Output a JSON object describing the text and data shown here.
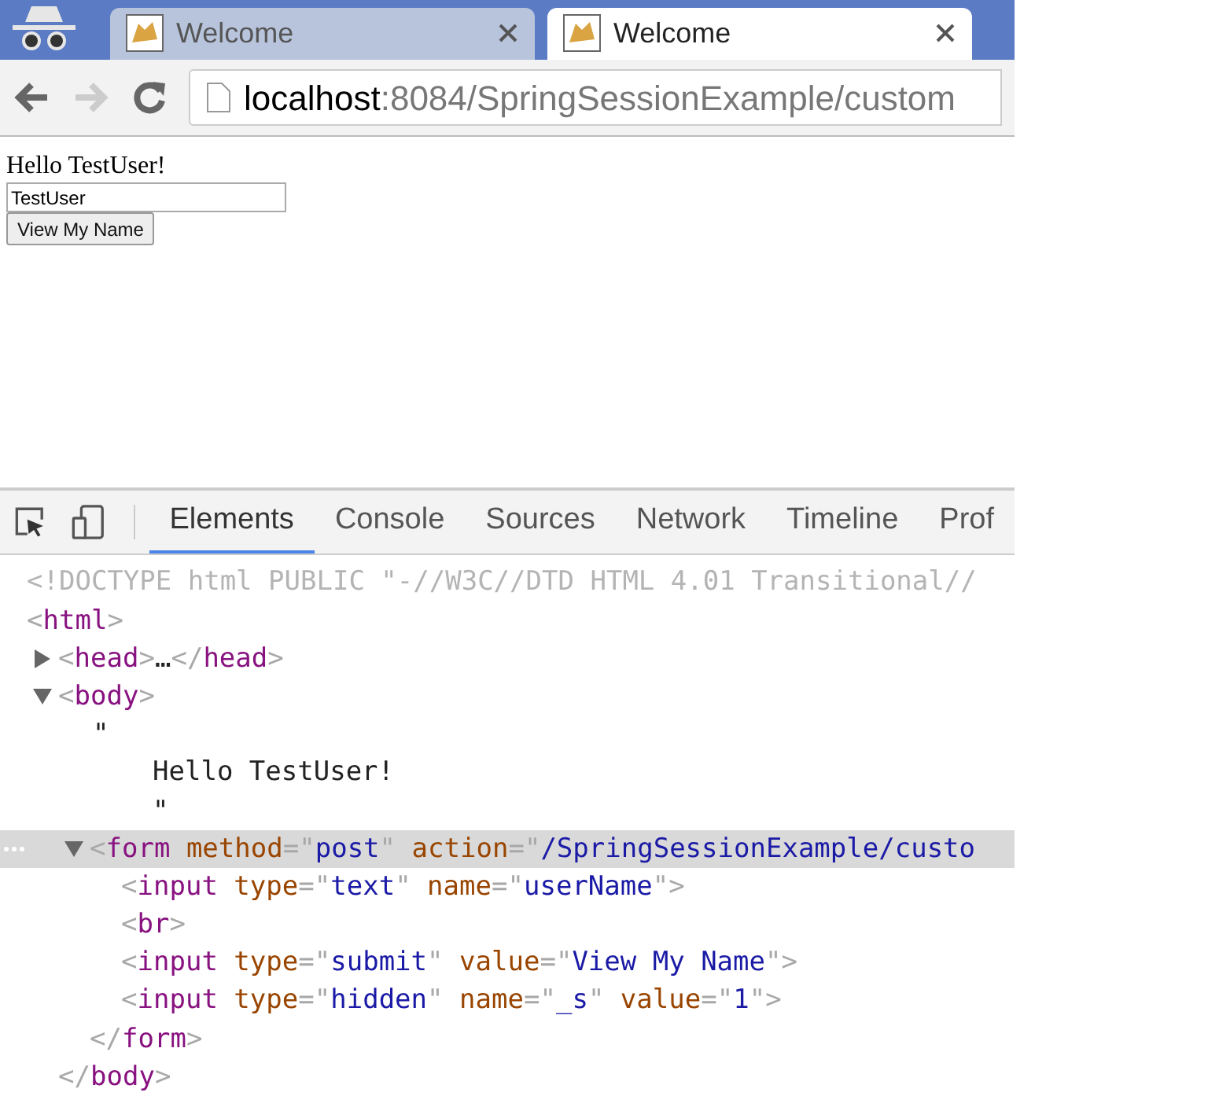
{
  "browser": {
    "tabs": [
      {
        "title": "Welcome",
        "selected": false
      },
      {
        "title": "Welcome",
        "selected": true
      }
    ],
    "address": {
      "host": "localhost",
      "rest": ":8084/SpringSessionExample/custom"
    }
  },
  "page": {
    "greeting": "Hello TestUser!",
    "name_field": {
      "value": "TestUser"
    },
    "submit_button": "View My Name"
  },
  "devtools": {
    "tabs": [
      {
        "label": "Elements",
        "selected": true
      },
      {
        "label": "Console",
        "selected": false
      },
      {
        "label": "Sources",
        "selected": false
      },
      {
        "label": "Network",
        "selected": false
      },
      {
        "label": "Timeline",
        "selected": false
      },
      {
        "label": "Prof",
        "selected": false
      }
    ],
    "dom": [
      {
        "kind": "element",
        "tokens": [
          {
            "kind": "doctype",
            "text": "<!DOCTYPE html PUBLIC \"-//W3C//DTD HTML 4.01 Transitional//"
          }
        ]
      },
      {
        "kind": "element",
        "tokens": [
          {
            "kind": "punct",
            "text": "<"
          },
          {
            "kind": "tag",
            "text": "html"
          },
          {
            "kind": "punct",
            "text": ">"
          }
        ],
        "children": [
          {
            "kind": "element",
            "expanded": false,
            "tokens": [
              {
                "kind": "punct",
                "text": "<"
              },
              {
                "kind": "tag",
                "text": "head"
              },
              {
                "kind": "punct",
                "text": ">"
              },
              {
                "kind": "text",
                "text": "…"
              },
              {
                "kind": "punct",
                "text": "</"
              },
              {
                "kind": "tag",
                "text": "head"
              },
              {
                "kind": "punct",
                "text": ">"
              }
            ]
          },
          {
            "kind": "element",
            "expanded": true,
            "tokens": [
              {
                "kind": "punct",
                "text": "<"
              },
              {
                "kind": "tag",
                "text": "body"
              },
              {
                "kind": "punct",
                "text": ">"
              }
            ],
            "children": [
              {
                "kind": "text",
                "lines": [
                  "\"",
                  "Hello TestUser!",
                  "\""
                ]
              },
              {
                "kind": "element",
                "expanded": true,
                "selected": true,
                "tokens": [
                  {
                    "kind": "punct",
                    "text": "<"
                  },
                  {
                    "kind": "tag",
                    "text": "form"
                  },
                  {
                    "kind": "attr",
                    "text": "method"
                  },
                  {
                    "kind": "punct",
                    "text": "=\""
                  },
                  {
                    "kind": "value",
                    "text": "post"
                  },
                  {
                    "kind": "punct",
                    "text": "\""
                  },
                  {
                    "kind": "attr",
                    "text": "action"
                  },
                  {
                    "kind": "punct",
                    "text": "=\""
                  },
                  {
                    "kind": "value",
                    "text": "/SpringSessionExample/custo"
                  }
                ],
                "children": [
                  {
                    "kind": "element",
                    "tokens": [
                      {
                        "kind": "punct",
                        "text": "<"
                      },
                      {
                        "kind": "tag",
                        "text": "input"
                      },
                      {
                        "kind": "attr",
                        "text": "type"
                      },
                      {
                        "kind": "punct",
                        "text": "=\""
                      },
                      {
                        "kind": "value",
                        "text": "text"
                      },
                      {
                        "kind": "punct",
                        "text": "\""
                      },
                      {
                        "kind": "attr",
                        "text": "name"
                      },
                      {
                        "kind": "punct",
                        "text": "=\""
                      },
                      {
                        "kind": "value",
                        "text": "userName"
                      },
                      {
                        "kind": "punct",
                        "text": "\">"
                      }
                    ]
                  },
                  {
                    "kind": "element",
                    "tokens": [
                      {
                        "kind": "punct",
                        "text": "<"
                      },
                      {
                        "kind": "tag",
                        "text": "br"
                      },
                      {
                        "kind": "punct",
                        "text": ">"
                      }
                    ]
                  },
                  {
                    "kind": "element",
                    "tokens": [
                      {
                        "kind": "punct",
                        "text": "<"
                      },
                      {
                        "kind": "tag",
                        "text": "input"
                      },
                      {
                        "kind": "attr",
                        "text": "type"
                      },
                      {
                        "kind": "punct",
                        "text": "=\""
                      },
                      {
                        "kind": "value",
                        "text": "submit"
                      },
                      {
                        "kind": "punct",
                        "text": "\""
                      },
                      {
                        "kind": "attr",
                        "text": "value"
                      },
                      {
                        "kind": "punct",
                        "text": "=\""
                      },
                      {
                        "kind": "value",
                        "text": "View My Name"
                      },
                      {
                        "kind": "punct",
                        "text": "\">"
                      }
                    ]
                  },
                  {
                    "kind": "element",
                    "tokens": [
                      {
                        "kind": "punct",
                        "text": "<"
                      },
                      {
                        "kind": "tag",
                        "text": "input"
                      },
                      {
                        "kind": "attr",
                        "text": "type"
                      },
                      {
                        "kind": "punct",
                        "text": "=\""
                      },
                      {
                        "kind": "value",
                        "text": "hidden"
                      },
                      {
                        "kind": "punct",
                        "text": "\""
                      },
                      {
                        "kind": "attr",
                        "text": "name"
                      },
                      {
                        "kind": "punct",
                        "text": "=\""
                      },
                      {
                        "kind": "value",
                        "text": "_s"
                      },
                      {
                        "kind": "punct",
                        "text": "\""
                      },
                      {
                        "kind": "attr",
                        "text": "value"
                      },
                      {
                        "kind": "punct",
                        "text": "=\""
                      },
                      {
                        "kind": "value",
                        "text": "1"
                      },
                      {
                        "kind": "punct",
                        "text": "\">"
                      }
                    ]
                  }
                ],
                "closing": [
                  {
                    "kind": "punct",
                    "text": "</"
                  },
                  {
                    "kind": "tag",
                    "text": "form"
                  },
                  {
                    "kind": "punct",
                    "text": ">"
                  }
                ]
              }
            ],
            "closing": [
              {
                "kind": "punct",
                "text": "</"
              },
              {
                "kind": "tag",
                "text": "body"
              },
              {
                "kind": "punct",
                "text": ">"
              }
            ]
          }
        ]
      }
    ]
  }
}
